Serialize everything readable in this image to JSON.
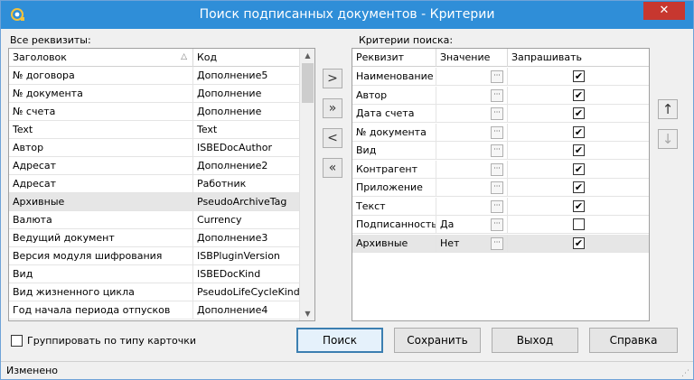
{
  "window": {
    "title": "Поиск подписанных документов - Критерии",
    "close": "✕"
  },
  "left": {
    "label": "Все реквизиты:",
    "columns": [
      "Заголовок",
      "Код"
    ],
    "rows": [
      [
        "№ договора",
        "Дополнение5"
      ],
      [
        "№ документа",
        "Дополнение"
      ],
      [
        "№ счета",
        "Дополнение"
      ],
      [
        "Text",
        "Text"
      ],
      [
        "Автор",
        "ISBEDocAuthor"
      ],
      [
        "Адресат",
        "Дополнение2"
      ],
      [
        "Адресат",
        "Работник"
      ],
      [
        "Архивные",
        "PseudoArchiveTag"
      ],
      [
        "Валюта",
        "Currency"
      ],
      [
        "Ведущий документ",
        "Дополнение3"
      ],
      [
        "Версия модуля шифрования",
        "ISBPluginVersion"
      ],
      [
        "Вид",
        "ISBEDocKind"
      ],
      [
        "Вид жизненного цикла",
        "PseudoLifeCycleKind"
      ],
      [
        "Год начала периода отпусков",
        "Дополнение4"
      ]
    ],
    "selected_row": 7
  },
  "move": {
    "add": ">",
    "add_all": "»",
    "remove": "<",
    "remove_all": "«"
  },
  "right": {
    "label": "Критерии поиска:",
    "columns": [
      "Реквизит",
      "Значение",
      "Запрашивать"
    ],
    "rows": [
      {
        "name": "Наименование",
        "value": "",
        "ask": true
      },
      {
        "name": "Автор",
        "value": "",
        "ask": true
      },
      {
        "name": "Дата счета",
        "value": "",
        "ask": true
      },
      {
        "name": "№ документа",
        "value": "",
        "ask": true
      },
      {
        "name": "Вид",
        "value": "",
        "ask": true
      },
      {
        "name": "Контрагент",
        "value": "",
        "ask": true
      },
      {
        "name": "Приложение",
        "value": "",
        "ask": true
      },
      {
        "name": "Текст",
        "value": "",
        "ask": true
      },
      {
        "name": "Подписанность",
        "value": "Да",
        "ask": false
      },
      {
        "name": "Архивные",
        "value": "Нет",
        "ask": true
      }
    ],
    "selected_row": 9,
    "ellipsis": "···"
  },
  "order": {
    "up": "↑",
    "down": "↓"
  },
  "group_checkbox": {
    "label": "Группировать по типу карточки",
    "checked": false
  },
  "buttons": {
    "search": "Поиск",
    "save": "Сохранить",
    "exit": "Выход",
    "help": "Справка"
  },
  "status": "Изменено"
}
